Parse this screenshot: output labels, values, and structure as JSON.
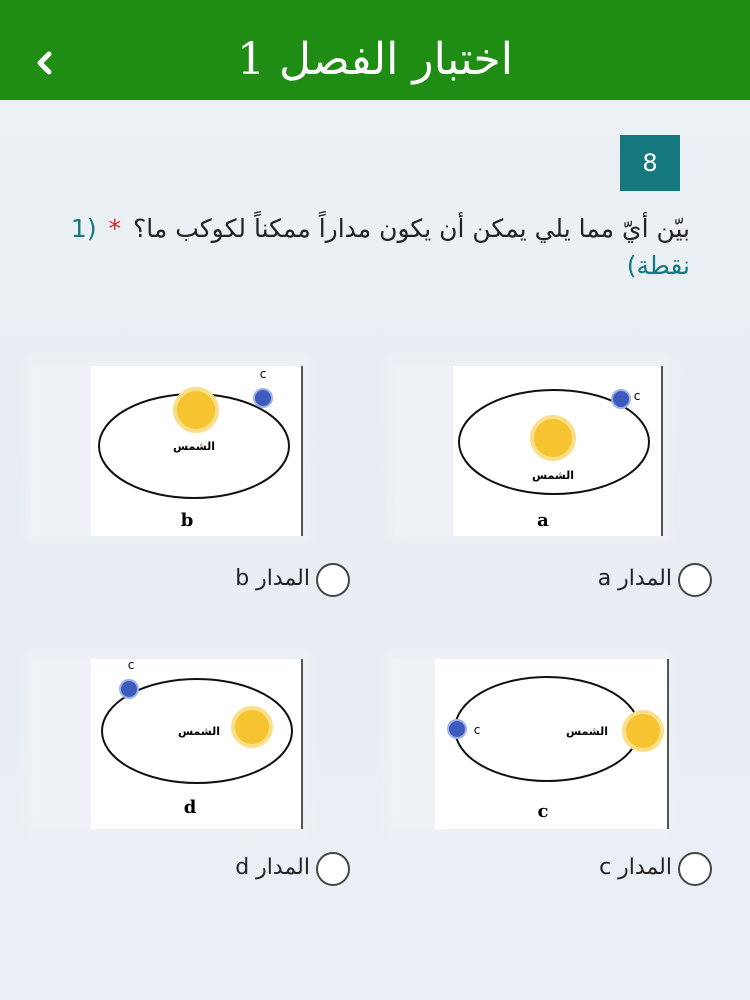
{
  "header": {
    "title": "اختبار الفصل 1",
    "back_icon": "chevron-left-icon",
    "bg_color": "#1f8c14"
  },
  "question": {
    "number": "8",
    "text": "بيّن أيّ مما يلي يمكن أن يكون مداراً ممكناً لكوكب ما؟",
    "required_mark": "*",
    "points": "(1 نقطة)"
  },
  "options": [
    {
      "id": "a",
      "diagram_letter": "a",
      "sun_label": "الشمس",
      "planet_label": "c",
      "choice_label": "المدار a"
    },
    {
      "id": "b",
      "diagram_letter": "b",
      "sun_label": "الشمس",
      "planet_label": "c",
      "choice_label": "المدار b"
    },
    {
      "id": "c",
      "diagram_letter": "c",
      "sun_label": "الشمس",
      "planet_label": "c",
      "choice_label": "المدار c"
    },
    {
      "id": "d",
      "diagram_letter": "d",
      "sun_label": "الشمس",
      "planet_label": "c",
      "choice_label": "المدار d"
    }
  ]
}
